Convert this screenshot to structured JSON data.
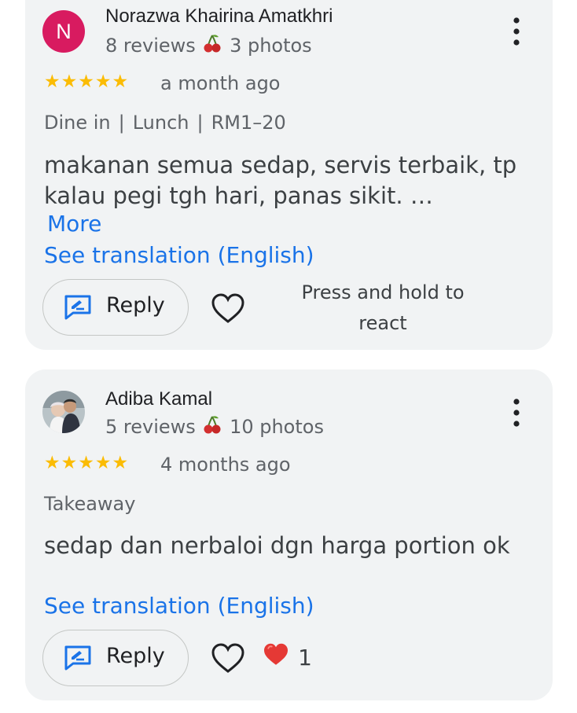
{
  "reviews": [
    {
      "avatar_letter": "N",
      "author": "Norazwa Khairina Amatkhri",
      "review_count": "8 reviews",
      "photo_count": "3 photos",
      "rating": 5,
      "stars": "★★★★★",
      "time": "a month ago",
      "tags": [
        "Dine in",
        "Lunch",
        "RM1–20"
      ],
      "text": "makanan semua sedap, servis terbaik, tp kalau pegi tgh hari, panas sikit. …",
      "more": "More",
      "translate": "See translation (English)",
      "reply": "Reply",
      "react_hint": "Press and hold to react"
    },
    {
      "author": "Adiba Kamal",
      "review_count": "5 reviews",
      "photo_count": "10 photos",
      "rating": 5,
      "stars": "★★★★★",
      "time": "4 months ago",
      "tags": [
        "Takeaway"
      ],
      "text": "sedap dan nerbaloi dgn harga portion ok",
      "translate": "See translation (English)",
      "reply": "Reply",
      "reaction_count": "1"
    }
  ],
  "icons": {
    "more": "more-vert-icon",
    "level_badge": "cherry-icon",
    "reply": "reply-edit-icon",
    "like": "heart-outline-icon",
    "reaction": "red-heart-icon"
  },
  "colors": {
    "card": "#f1f3f4",
    "avatar": "#d81b60",
    "star": "#fbbc04",
    "link": "#1a73e8",
    "reaction": "#e53935"
  }
}
